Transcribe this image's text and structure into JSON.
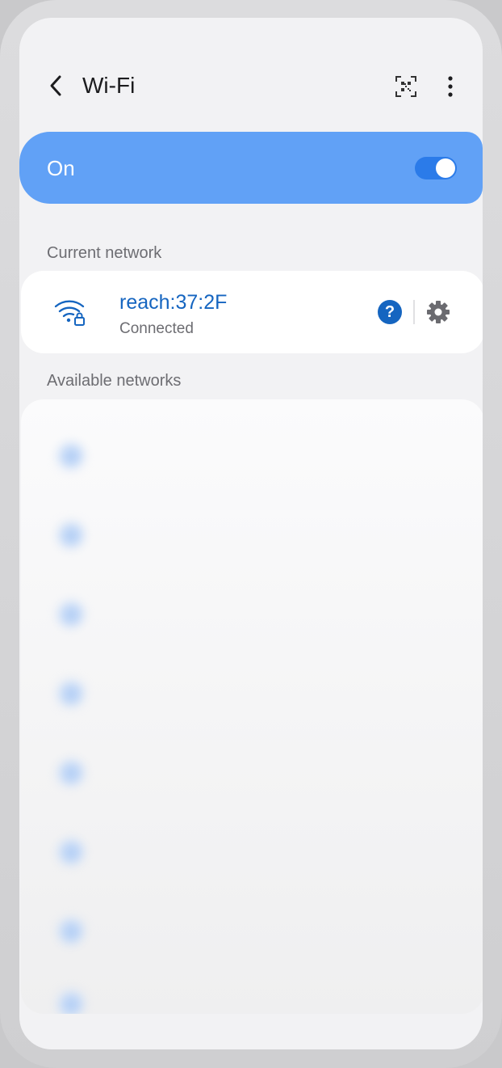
{
  "appbar": {
    "title": "Wi-Fi",
    "back_icon": "chevron-left-icon",
    "qr_icon": "qr-scan-icon",
    "more_icon": "more-vertical-icon"
  },
  "wifi_toggle": {
    "label": "On",
    "enabled": true,
    "color": "#61a1f6"
  },
  "current_network": {
    "header": "Current network",
    "name": "reach:37:2F",
    "status": "Connected",
    "icon": "wifi-lock-icon",
    "help_label": "?",
    "settings_icon": "gear-icon",
    "name_color": "#1565c0"
  },
  "available_networks": {
    "header": "Available networks",
    "items": [
      {
        "label": "",
        "icon": "wifi-icon"
      },
      {
        "label": "",
        "icon": "wifi-icon"
      },
      {
        "label": "",
        "icon": "wifi-icon"
      },
      {
        "label": "",
        "icon": "wifi-icon"
      },
      {
        "label": "",
        "icon": "wifi-icon"
      },
      {
        "label": "",
        "icon": "wifi-icon"
      },
      {
        "label": "",
        "icon": "wifi-icon"
      },
      {
        "label": "",
        "icon": "wifi-icon"
      }
    ]
  }
}
